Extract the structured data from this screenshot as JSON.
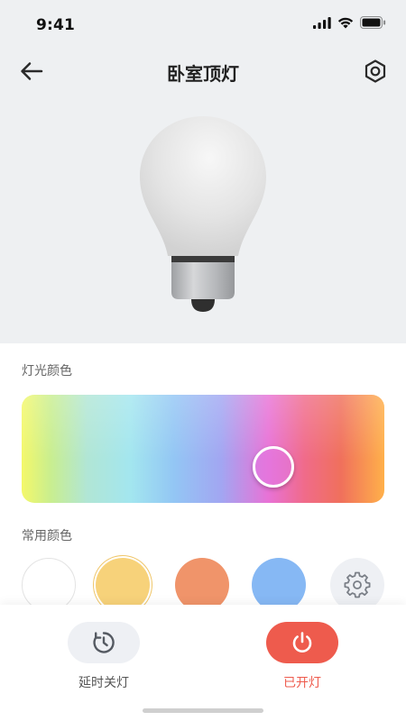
{
  "status_bar": {
    "time": "9:41",
    "icons": [
      "cellular-signal-icon",
      "wifi-icon",
      "battery-icon"
    ]
  },
  "nav": {
    "title": "卧室顶灯",
    "back_icon": "arrow-left-icon",
    "settings_icon": "hexagon-settings-icon"
  },
  "light_color": {
    "label": "灯光颜色",
    "gradient_colors": [
      "#f4f86a",
      "#b1e6d5",
      "#a3e6ef",
      "#93c6f4",
      "#a2a6f2",
      "#e872d6",
      "#f06b8a",
      "#f0705c",
      "#ffb04a"
    ]
  },
  "common_colors": {
    "label": "常用颜色",
    "presets": [
      {
        "name": "white",
        "color": "#ffffff"
      },
      {
        "name": "warm-yellow",
        "color": "#f7d27a",
        "selected": true
      },
      {
        "name": "orange",
        "color": "#f0946a"
      },
      {
        "name": "blue",
        "color": "#86b8f4"
      },
      {
        "name": "custom",
        "icon": "gear-icon"
      }
    ]
  },
  "bottom_actions": {
    "timer_label": "延时关灯",
    "timer_icon": "timer-clock-icon",
    "power_label": "已开灯",
    "power_icon": "power-icon",
    "power_color": "#ee5b4d"
  }
}
